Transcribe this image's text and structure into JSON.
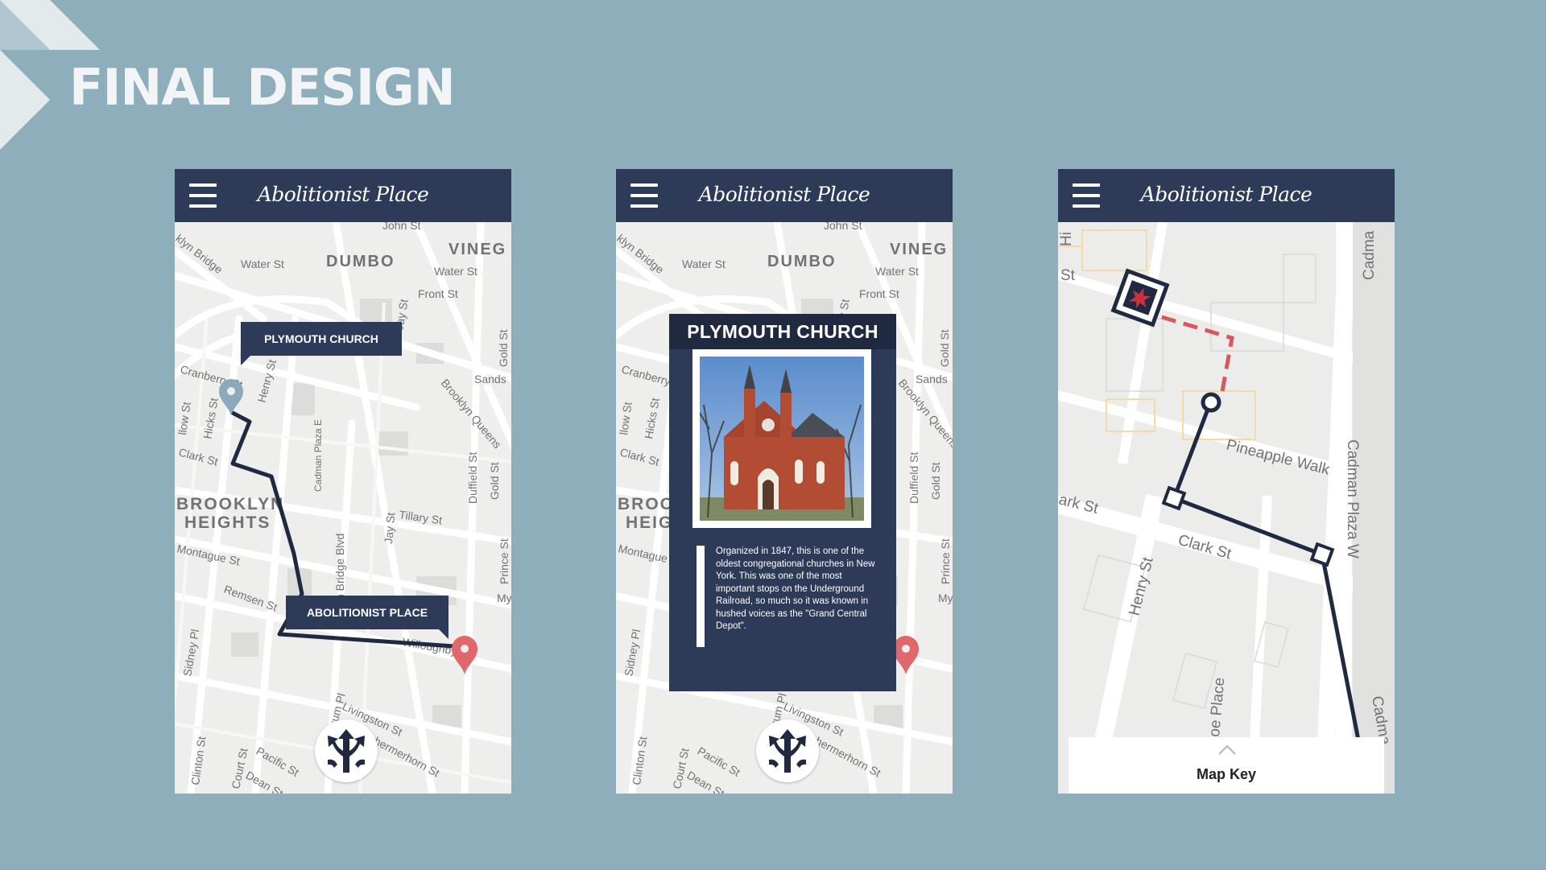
{
  "page": {
    "title": "FINAL DESIGN"
  },
  "app": {
    "logo": "Abolitionist Place",
    "menu_icon": "hamburger-icon"
  },
  "screen1": {
    "callout_top": "PLYMOUTH CHURCH",
    "callout_bottom": "ABOLITIONIST PLACE",
    "fab_icon": "directions-arrows-icon",
    "colors": {
      "route": "#1f2a40",
      "start_pin": "#8aaabb",
      "end_pin": "#e0676a"
    }
  },
  "screen2": {
    "card_title": "PLYMOUTH CHURCH",
    "card_text": "Organized in 1847, this is one of the oldest congregational churches in New York. This was one of the most important stops on the Underground Railroad, so much so it was known in hushed voices as the \"Grand Central Depot\".",
    "fab_icon": "directions-arrows-icon"
  },
  "screen3": {
    "map_key_label": "Map Key",
    "colors": {
      "route": "#1f2a40",
      "dashed_route": "#d9575f",
      "star": "#c8323c"
    }
  },
  "map_labels": {
    "john_st": "John St",
    "vinegar": "VINEG",
    "bridge": "klyn Bridge",
    "water_st_1": "Water St",
    "dumbo": "DUMBO",
    "water_st_2": "Water St",
    "front_st": "Front St",
    "jay_st": "Jay St",
    "gold_st": "Gold St",
    "sands": "Sands",
    "brooklyn_queens": "Brooklyn Queens",
    "cranberry": "Cranberry St",
    "henry_st": "Henry St",
    "willow_st": "llow St",
    "hicks_st": "Hicks St",
    "clark_st": "Clark St",
    "cadman": "Cadman Plaza E",
    "brooklyn": "BROOKLYN",
    "heights": "HEIGHTS",
    "tillary_st": "Tillary St",
    "duffield_st": "Duffield St",
    "gold_st_2": "Gold St",
    "montague_st": "Montague St",
    "remsen_st": "Remsen St",
    "brooklyn_bridge_blvd": "n Bridge Blvd",
    "jay_st_2": "Jay St",
    "prince_st": "Prince St",
    "my": "My",
    "willoughby": "Willoughby",
    "sidney_pl": "Sidney Pl",
    "boerum_pl": "Boerum Pl",
    "livingston_st": "Livingston St",
    "schermerhorn_st": "Schermerhorn St",
    "clinton_st": "Clinton St",
    "court_st": "Court St",
    "pacific_st": "Pacific St",
    "dean_st": "Dean St",
    "ve": "ve",
    "es": "e St"
  },
  "map3_labels": {
    "st": "St",
    "hi": "Hi",
    "cadma": "Cadma",
    "pineapple_walk": "Pineapple Walk",
    "cadman_plaza_w": "Cadman Plaza W",
    "ark_st": "ark St",
    "clark_st": "Clark St",
    "henry_st": "Henry St",
    "joe_place": "oe Place",
    "cadma2": "Cadma"
  }
}
